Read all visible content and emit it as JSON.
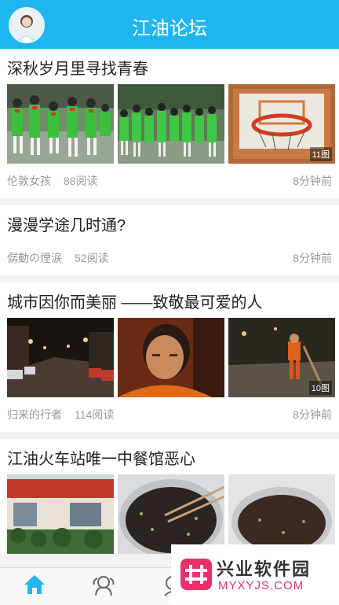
{
  "header": {
    "title": "江油论坛",
    "avatar_icon": "user-avatar"
  },
  "posts": [
    {
      "title": "深秋岁月里寻找青春",
      "author": "伦敦女孩",
      "reads": "88阅读",
      "time": "8分钟前",
      "image_count": "11图"
    },
    {
      "title": "漫漫学途几时通?",
      "author": "僝動の煙涙",
      "reads": "52阅读",
      "time": "8分钟前"
    },
    {
      "title": "城市因你而美丽 ——致敬最可爱的人",
      "author": "归来的行者",
      "reads": "114阅读",
      "time": "8分钟前",
      "image_count": "10图"
    },
    {
      "title": "江油火车站唯一中餐馆恶心"
    }
  ],
  "tabbar": {
    "icons": [
      "home-icon",
      "friends-icon",
      "user-icon"
    ],
    "active_color": "#1fb6f0"
  },
  "watermark": {
    "name": "兴业软件园",
    "site": "MYXYJS.COM"
  },
  "colors": {
    "header": "#1fb6f0",
    "meta_text": "#999999"
  }
}
